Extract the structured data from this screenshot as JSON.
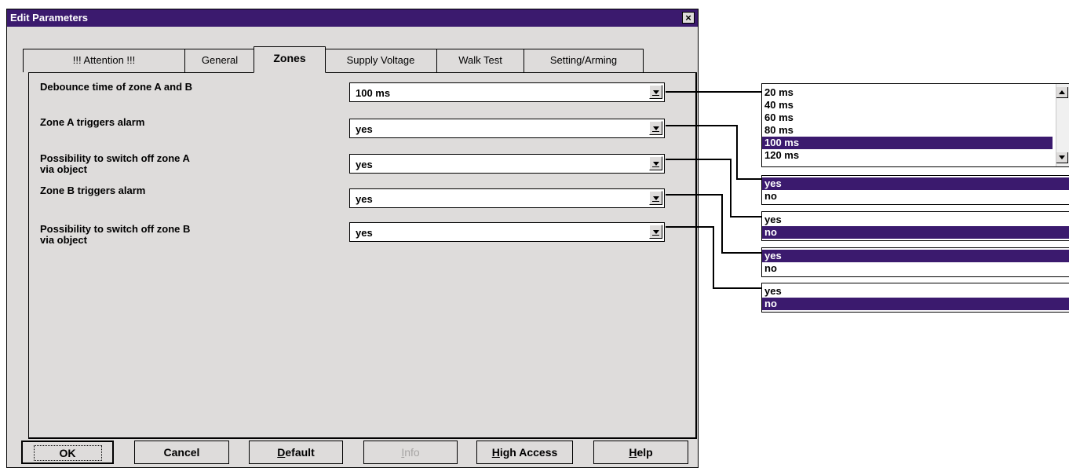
{
  "window": {
    "title": "Edit Parameters"
  },
  "tabs": [
    {
      "label": "!!! Attention !!!"
    },
    {
      "label": "General"
    },
    {
      "label": "Zones",
      "active": true
    },
    {
      "label": "Supply Voltage"
    },
    {
      "label": "Walk Test"
    },
    {
      "label": "Setting/Arming"
    }
  ],
  "params": [
    {
      "label": "Debounce time of zone A and B",
      "value": "100 ms"
    },
    {
      "label": "Zone A triggers alarm",
      "value": "yes"
    },
    {
      "label_line1": "Possibility to switch off zone A",
      "label_line2": "via object",
      "value": "yes"
    },
    {
      "label": "Zone B triggers alarm",
      "value": "yes"
    },
    {
      "label_line1": "Possibility to switch off zone B",
      "label_line2": "via object",
      "value": "yes"
    }
  ],
  "buttons": {
    "ok": "OK",
    "cancel": "Cancel",
    "default_rest": "efault",
    "default_key": "D",
    "info_key": "I",
    "info_rest": "nfo",
    "high_key": "H",
    "high_rest": "igh Access",
    "help_key": "H",
    "help_rest": "elp"
  },
  "dropdowns": {
    "debounce": {
      "options": [
        "20 ms",
        "40 ms",
        "60 ms",
        "80 ms",
        "100 ms",
        "120 ms"
      ],
      "selected": "100 ms"
    },
    "zone_a_alarm": {
      "options": [
        "yes",
        "no"
      ],
      "selected": "yes"
    },
    "zone_a_switch": {
      "options": [
        "yes",
        "no"
      ],
      "selected": "no"
    },
    "zone_b_alarm": {
      "options": [
        "yes",
        "no"
      ],
      "selected": "yes"
    },
    "zone_b_switch": {
      "options": [
        "yes",
        "no"
      ],
      "selected": "no"
    }
  },
  "colors": {
    "title_bar": "#3b1a6e",
    "selection": "#3b1a6e",
    "dialog_bg": "#dedcdb"
  }
}
